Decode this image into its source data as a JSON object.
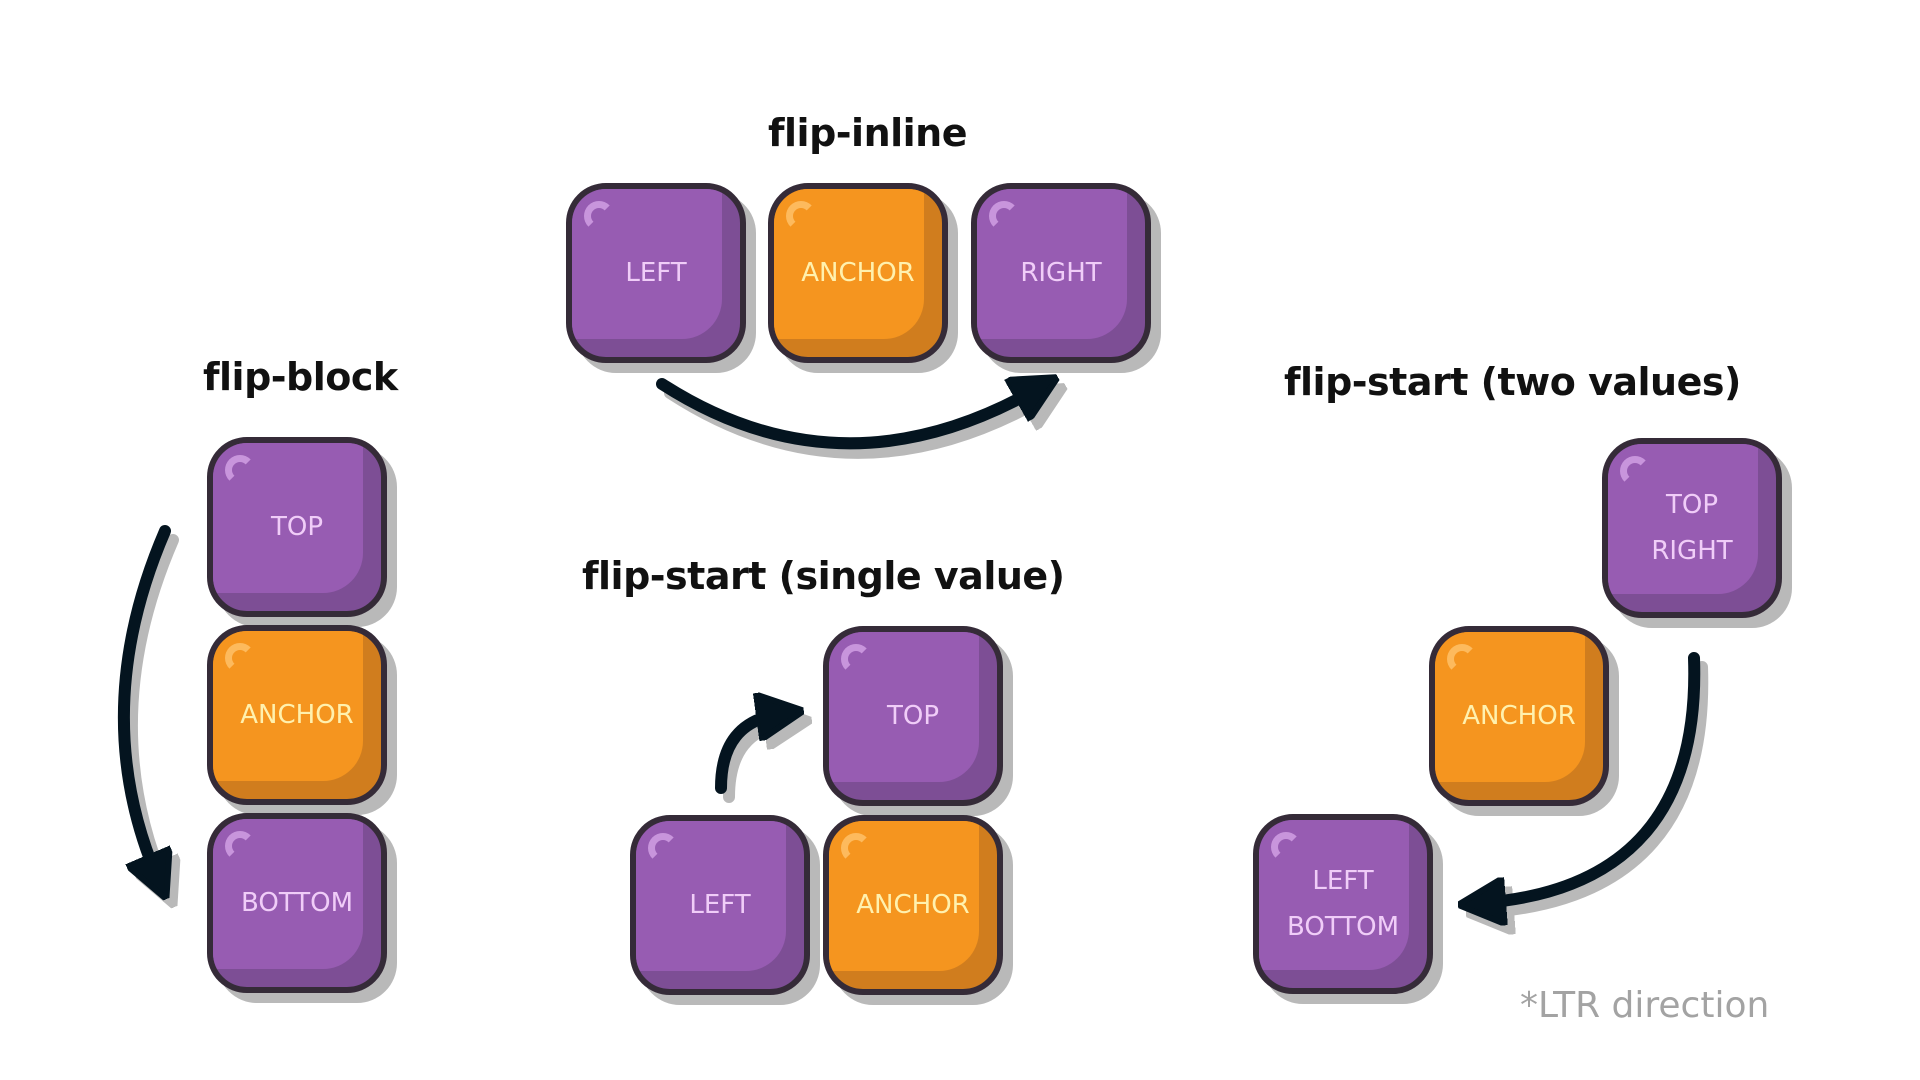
{
  "titles": {
    "flip_inline": "flip-inline",
    "flip_block": "flip-block",
    "flip_start_single": "flip-start (single value)",
    "flip_start_two": "flip-start (two values)"
  },
  "note": "*LTR direction",
  "colors": {
    "purple": "#975cb2",
    "orange": "#f5951f",
    "border": "#352b38",
    "arrow": "#04141f",
    "shadow": "#b9b9b9",
    "note": "#a3a3a3"
  },
  "flip_inline": {
    "boxes": [
      {
        "label": [
          "LEFT"
        ],
        "type": "position"
      },
      {
        "label": [
          "ANCHOR"
        ],
        "type": "anchor"
      },
      {
        "label": [
          "RIGHT"
        ],
        "type": "position"
      }
    ],
    "arrow": {
      "from": "LEFT",
      "to": "RIGHT"
    }
  },
  "flip_block": {
    "boxes": [
      {
        "label": [
          "TOP"
        ],
        "type": "position"
      },
      {
        "label": [
          "ANCHOR"
        ],
        "type": "anchor"
      },
      {
        "label": [
          "BOTTOM"
        ],
        "type": "position"
      }
    ],
    "arrow": {
      "from": "TOP",
      "to": "BOTTOM"
    }
  },
  "flip_start_single": {
    "boxes": [
      {
        "label": [
          "TOP"
        ],
        "type": "position"
      },
      {
        "label": [
          "LEFT"
        ],
        "type": "position"
      },
      {
        "label": [
          "ANCHOR"
        ],
        "type": "anchor"
      }
    ],
    "arrow": {
      "from": "LEFT",
      "to": "TOP"
    }
  },
  "flip_start_two": {
    "boxes": [
      {
        "label": [
          "TOP",
          "RIGHT"
        ],
        "type": "position"
      },
      {
        "label": [
          "ANCHOR"
        ],
        "type": "anchor"
      },
      {
        "label": [
          "LEFT",
          "BOTTOM"
        ],
        "type": "position"
      }
    ],
    "arrow": {
      "from": "TOP RIGHT",
      "to": "LEFT BOTTOM"
    }
  }
}
